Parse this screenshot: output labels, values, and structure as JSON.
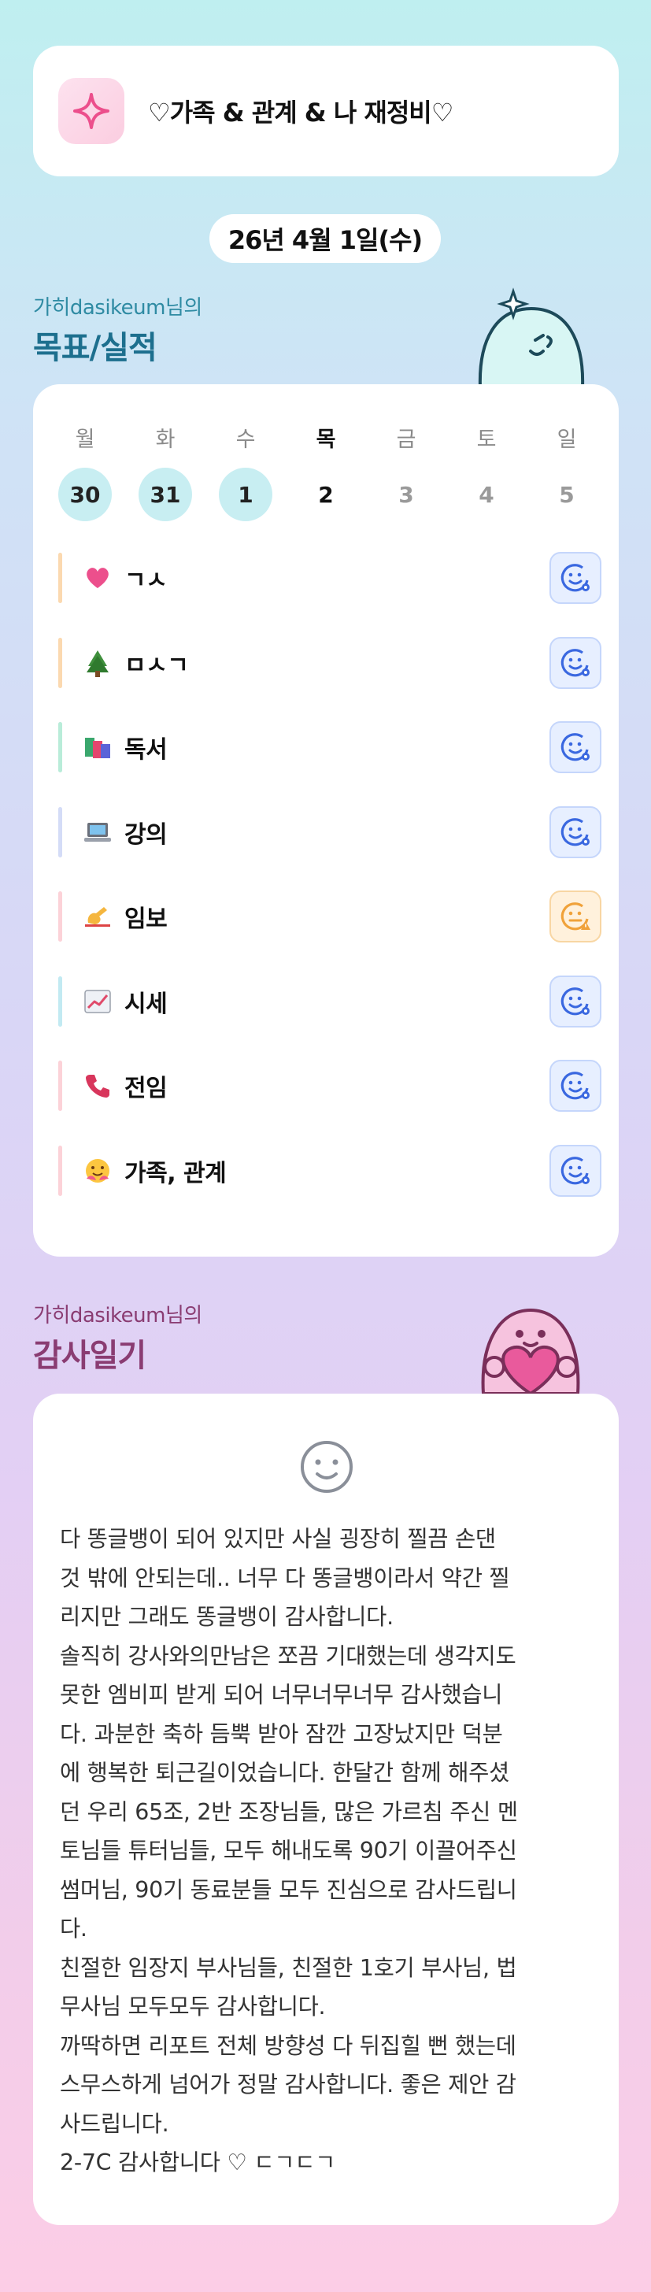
{
  "header": {
    "title": "♡가족 & 관계 & 나 재정비♡",
    "date": "26년 4월 1일(수)"
  },
  "goals_section": {
    "subtitle": "가히dasikeum님의",
    "title": "목표/실적"
  },
  "calendar": {
    "weekdays": [
      "월",
      "화",
      "수",
      "목",
      "금",
      "토",
      "일"
    ],
    "days": [
      "30",
      "31",
      "1",
      "2",
      "3",
      "4",
      "5"
    ]
  },
  "goals": [
    {
      "name": "ㄱㅅ",
      "icon": "heart-icon",
      "bar_color": "#fbd9b0",
      "status": "done"
    },
    {
      "name": "ㅁㅅㄱ",
      "icon": "tree-icon",
      "bar_color": "#fbd9b0",
      "status": "done"
    },
    {
      "name": "독서",
      "icon": "books-icon",
      "bar_color": "#b9ecd9",
      "status": "done"
    },
    {
      "name": "강의",
      "icon": "laptop-icon",
      "bar_color": "#d4dcf7",
      "status": "done"
    },
    {
      "name": "임보",
      "icon": "writing-hand-icon",
      "bar_color": "#fcd2d8",
      "status": "warning"
    },
    {
      "name": "시세",
      "icon": "chart-icon",
      "bar_color": "#c2eaf2",
      "status": "done"
    },
    {
      "name": "전임",
      "icon": "phone-icon",
      "bar_color": "#fcd2d8",
      "status": "done"
    },
    {
      "name": "가족, 관계",
      "icon": "hug-face-icon",
      "bar_color": "#fcd2d8",
      "status": "done"
    }
  ],
  "thanks_section": {
    "subtitle": "가히dasikeum님의",
    "title": "감사일기"
  },
  "diary": {
    "lines": [
      "다 똥글뱅이 되어 있지만 사실 굉장히 찔끔 손댄",
      "것 밖에 안되는데.. 너무 다 똥글뱅이라서 약간 찔",
      "리지만 그래도 똥글뱅이 감사합니다.",
      "솔직히 강사와의만남은 쪼끔 기대했는데 생각지도",
      "못한 엠비피 받게 되어 너무너무너무 감사했습니",
      "다. 과분한 축하 듬뿍 받아 잠깐 고장났지만 덕분",
      "에 행복한 퇴근길이었습니다. 한달간 함께 해주셨",
      "던 우리 65조, 2반 조장님들, 많은 가르침 주신 멘",
      "토님들 튜터님들, 모두 해내도록 90기 이끌어주신",
      "썸머님, 90기 동료분들 모두 진심으로 감사드립니",
      "다.",
      "친절한 임장지 부사님들, 친절한 1호기 부사님, 법",
      "무사님 모두모두 감사합니다.",
      "까딱하면 리포트 전체 방향성 다 뒤집힐 뻔 했는데",
      "스무스하게 넘어가 정말 감사합니다. 좋은 제안 감",
      "사드립니다.",
      "2-7C 감사합니다 ♡ ㄷㄱㄷㄱ"
    ]
  },
  "colors": {
    "accent_teal": "#1d6f8e",
    "accent_plum": "#8a3c72",
    "status_ok": "#3a68e0",
    "status_warn": "#f0a23a"
  }
}
